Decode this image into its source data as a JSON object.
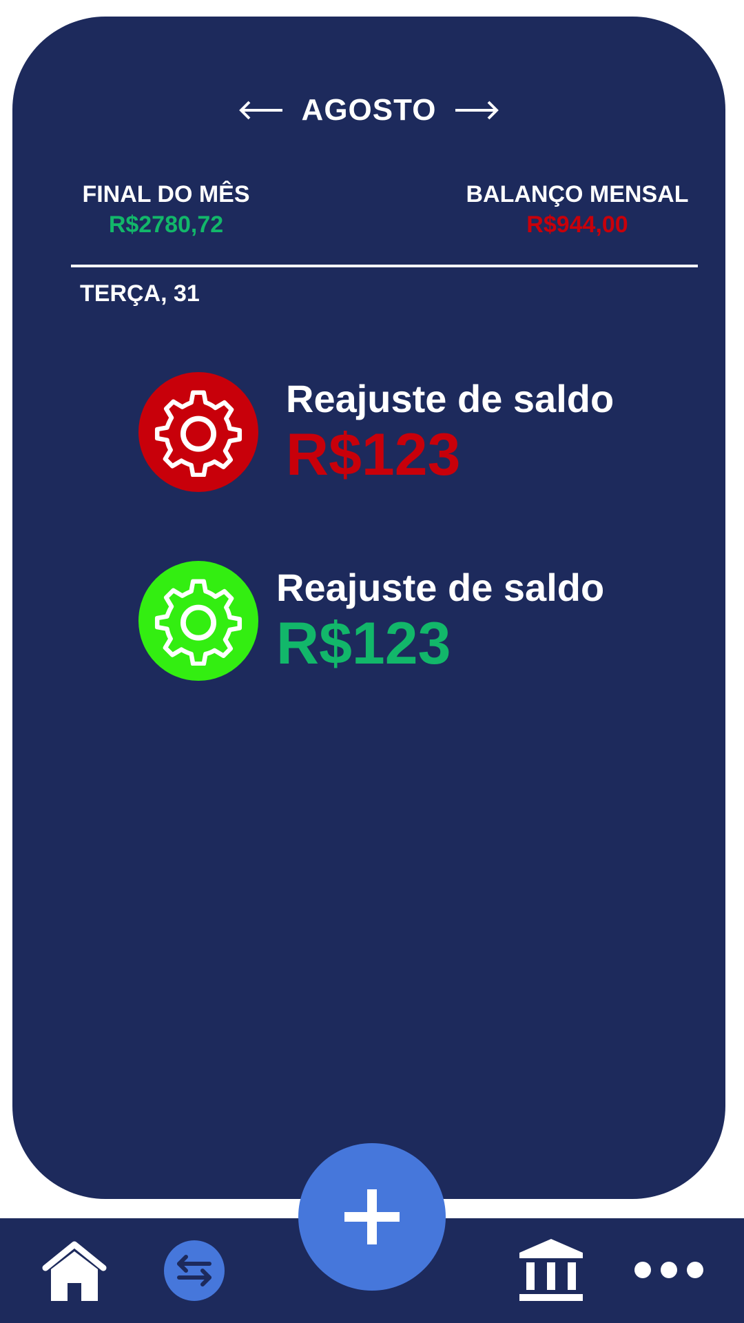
{
  "header": {
    "month": "AGOSTO",
    "prev_icon": "arrow-left-icon",
    "next_icon": "arrow-right-icon"
  },
  "summary": {
    "end_of_month": {
      "label": "FINAL DO MÊS",
      "value": "R$2780,72",
      "color": "#12b76a"
    },
    "monthly_balance": {
      "label": "BALANÇO MENSAL",
      "value": "R$944,00",
      "color": "#c8000a"
    }
  },
  "day": {
    "label": "TERÇA, 31"
  },
  "transactions": [
    {
      "title": "Reajuste de saldo",
      "amount": "R$123",
      "icon": "gear-icon",
      "icon_bg": "#c8000a",
      "amount_color": "#c8000a"
    },
    {
      "title": "Reajuste de saldo",
      "amount": "R$123",
      "icon": "gear-icon",
      "icon_bg": "#33ee11",
      "amount_color": "#12b76a"
    }
  ],
  "bottom_nav": {
    "items": [
      "home-icon",
      "transfer-icon",
      "add-icon",
      "bank-icon",
      "more-icon"
    ]
  },
  "colors": {
    "background": "#1d2a5c",
    "accent": "#4677db",
    "text": "#ffffff"
  }
}
